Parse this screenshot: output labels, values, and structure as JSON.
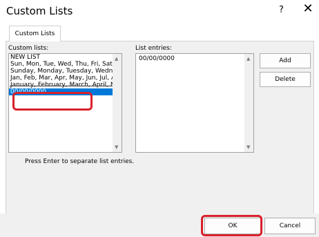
{
  "dialog": {
    "title": "Custom Lists",
    "help": "?",
    "close": "✕"
  },
  "tab": {
    "label": "Custom Lists"
  },
  "custom_lists": {
    "label": "Custom lists:",
    "items": [
      "NEW LIST",
      "Sun, Mon, Tue, Wed, Thu, Fri, Sat",
      "Sunday, Monday, Tuesday, Wednes",
      "Jan, Feb, Mar, Apr, May, Jun, Jul, Au",
      "January, February, March, April, Ma",
      "00/00/0000"
    ],
    "selected_index": 5
  },
  "list_entries": {
    "label": "List entries:",
    "value": "00/00/0000"
  },
  "buttons": {
    "add": "Add",
    "delete": "Delete",
    "ok": "OK",
    "cancel": "Cancel"
  },
  "note": "Press Enter to separate list entries.",
  "colors": {
    "selection": "#0078d7",
    "highlight": "#d9202c"
  }
}
